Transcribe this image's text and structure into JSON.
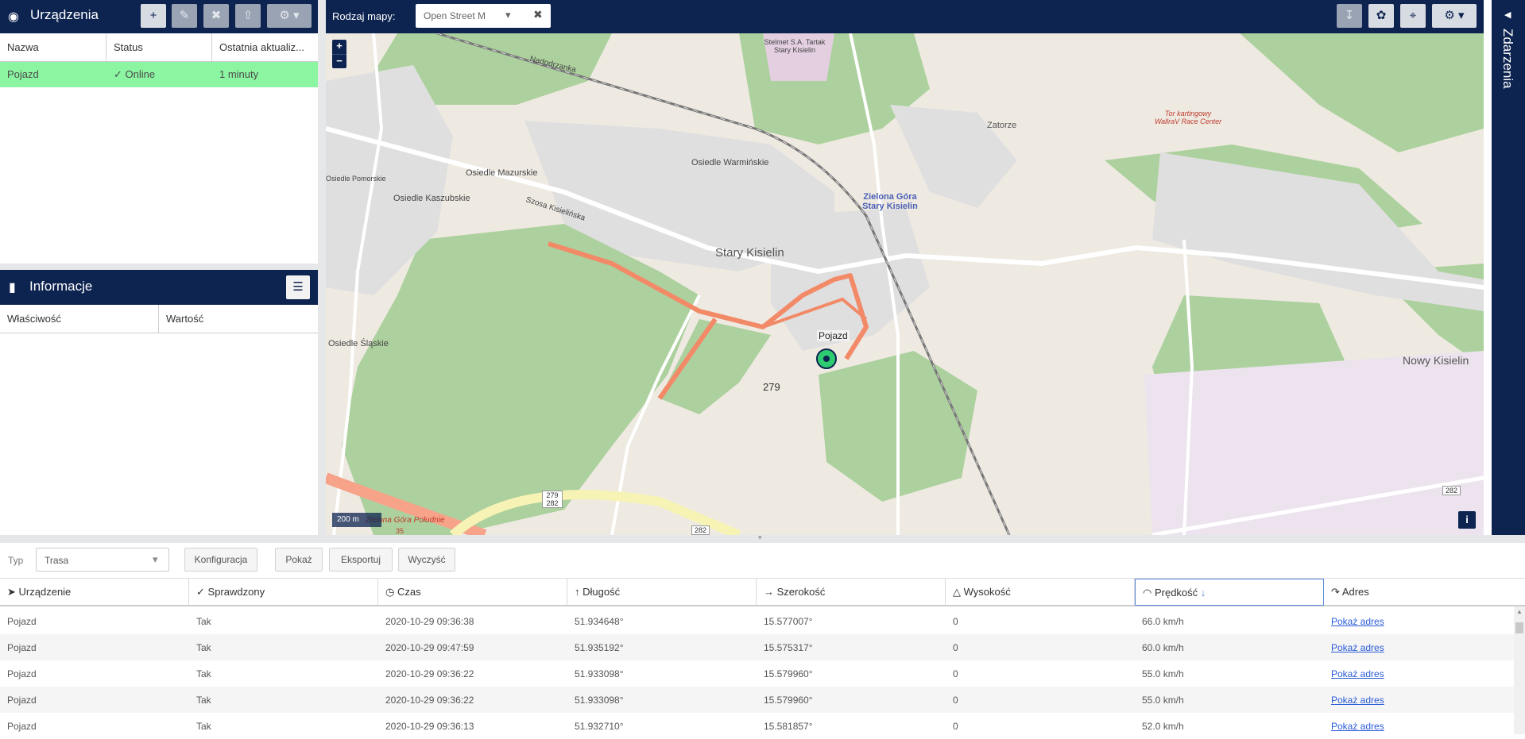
{
  "devices": {
    "title": "Urządzenia",
    "columns": [
      "Nazwa",
      "Status",
      "Ostatnia aktualiz..."
    ],
    "rows": [
      {
        "name": "Pojazd",
        "status": "Online",
        "last_update": "1 minuty"
      }
    ]
  },
  "info": {
    "title": "Informacje",
    "columns": [
      "Właściwość",
      "Wartość"
    ]
  },
  "map_header": {
    "map_type_label": "Rodzaj mapy:",
    "map_type_value": "Open Street M"
  },
  "map": {
    "zoom_in": "+",
    "zoom_out": "−",
    "scale": "200 m",
    "vehicle_label": "Pojazd",
    "info_button": "i",
    "labels": {
      "stary_kisielin": "Stary Kisielin",
      "nowy_kisielin": "Nowy Kisielin",
      "zatorze": "Zatorze",
      "zielona_gora_stary_kisielin": "Zielona Góra Stary Kisielin",
      "osiedle_mazurskie": "Osiedle Mazurskie",
      "osiedle_kaszubskie": "Osiedle Kaszubskie",
      "osiedle_warminskie": "Osiedle Warmińskie",
      "osiedle_slaskie": "Osiedle Śląskie",
      "osiedle_pomorskie": "Osiedle Pomorskie",
      "szosa_kisielinska": "Szosa Kisielińska",
      "nadodrzanka": "Nadodrzanka",
      "tor_kartingowy": "Tor kartingowy WallraV Race Center",
      "stelmet": "Stelmet S.A. Tartak Stary Kisielin",
      "zielona_gora_poludnie": "Zielona Góra Południe",
      "route_279": "279",
      "route_282": "282",
      "route_279_282": "279 282",
      "route_35": "35"
    }
  },
  "events": {
    "title": "Zdarzenia"
  },
  "report": {
    "type_label": "Typ",
    "type_value": "Trasa",
    "buttons": [
      "Konfiguracja",
      "Pokaż",
      "Eksportuj",
      "Wyczyść"
    ],
    "columns": [
      "Urządzenie",
      "Sprawdzony",
      "Czas",
      "Długość",
      "Szerokość",
      "Wysokość",
      "Prędkość",
      "Adres"
    ],
    "rows": [
      [
        "Pojazd",
        "Tak",
        "2020-10-29 09:36:38",
        "51.934648°",
        "15.577007°",
        "0",
        "66.0 km/h",
        "Pokaż adres"
      ],
      [
        "Pojazd",
        "Tak",
        "2020-10-29 09:47:59",
        "51.935192°",
        "15.575317°",
        "0",
        "60.0 km/h",
        "Pokaż adres"
      ],
      [
        "Pojazd",
        "Tak",
        "2020-10-29 09:36:22",
        "51.933098°",
        "15.579960°",
        "0",
        "55.0 km/h",
        "Pokaż adres"
      ],
      [
        "Pojazd",
        "Tak",
        "2020-10-29 09:36:22",
        "51.933098°",
        "15.579960°",
        "0",
        "55.0 km/h",
        "Pokaż adres"
      ],
      [
        "Pojazd",
        "Tak",
        "2020-10-29 09:36:13",
        "51.932710°",
        "15.581857°",
        "0",
        "52.0 km/h",
        "Pokaż adres"
      ]
    ]
  },
  "colors": {
    "header_bg": "#0d2350",
    "selected_row": "#8cf5a2",
    "route": "#f28a68",
    "forest": "#add19e",
    "residential": "#e0dfdf"
  }
}
